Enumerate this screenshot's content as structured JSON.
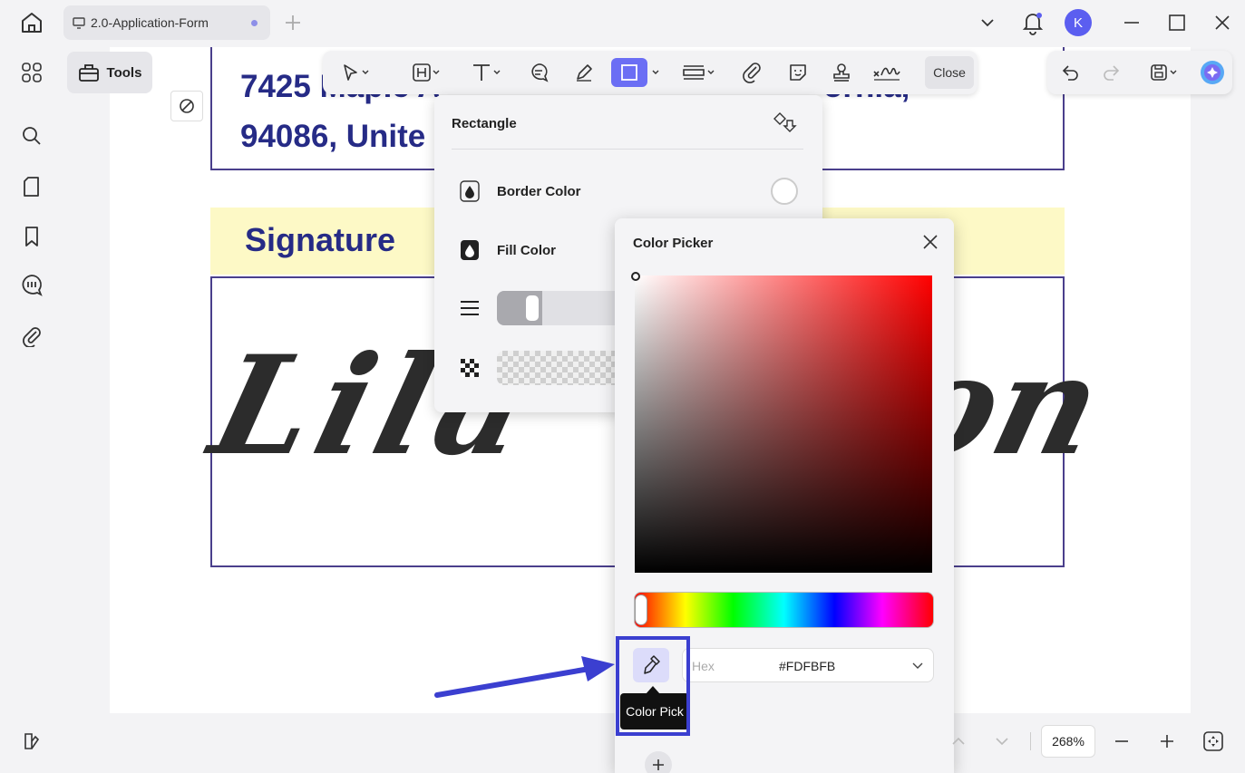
{
  "window": {
    "tab_title": "2.0-Application-Form",
    "avatar_letter": "K",
    "accent": "#5b5ef0"
  },
  "sidebar": {
    "tools_label": "Tools",
    "icons": [
      "grid-icon",
      "search-icon",
      "page-icon",
      "bookmark-icon",
      "comment-icon",
      "attachment-icon"
    ]
  },
  "toolbar": {
    "close_label": "Close",
    "active_tool": "rectangle"
  },
  "document": {
    "address_line1": "7425 Maple A",
    "address_line1_tail": "ornia,",
    "address_line2": "94086, Unite",
    "signature_heading": "Signature",
    "signature_part1": "Lila",
    "signature_part2": "on"
  },
  "rectangle_panel": {
    "title": "Rectangle",
    "border_color_label": "Border Color",
    "fill_color_label": "Fill Color"
  },
  "color_picker": {
    "title": "Color Picker",
    "hex_placeholder": "Hex",
    "hex_value": "#FDFBFB",
    "tooltip": "Color Pick"
  },
  "status_bar": {
    "zoom": "268%"
  }
}
